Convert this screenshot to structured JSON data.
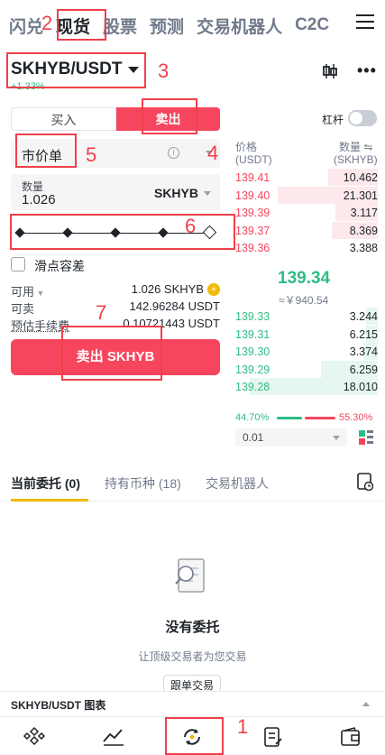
{
  "top_nav": {
    "items": [
      "闪兑",
      "现货",
      "股票",
      "预测",
      "交易机器人",
      "C2C"
    ],
    "active_index": 1
  },
  "annotations": [
    "1",
    "2",
    "3",
    "4",
    "5",
    "6",
    "7"
  ],
  "pair": {
    "symbol": "SKHYB/USDT",
    "change": "+1.33%"
  },
  "trade_form": {
    "buy_tab": "买入",
    "sell_tab": "卖出",
    "leverage_label": "杠杆",
    "order_type": "市价单",
    "quantity_label": "数量",
    "quantity_value": "1.026",
    "quantity_unit": "SKHYB",
    "slider_percent": 100,
    "slippage_label": "滑点容差",
    "available_label": "可用",
    "available_value": "1.026 SKHYB",
    "sellable_label": "可卖",
    "sellable_value": "142.96284 USDT",
    "fee_label": "预估手续费",
    "fee_value": "0.10721443 USDT",
    "submit_label": "卖出 SKHYB"
  },
  "order_book": {
    "price_header": "价格",
    "price_unit": "(USDT)",
    "qty_header": "数量 ⇋",
    "qty_unit": "(SKHYB)",
    "asks": [
      {
        "price": "139.41",
        "qty": "10.462",
        "depth": 0.35
      },
      {
        "price": "139.40",
        "qty": "21.301",
        "depth": 0.7
      },
      {
        "price": "139.39",
        "qty": "3.117",
        "depth": 0.3
      },
      {
        "price": "139.37",
        "qty": "8.369",
        "depth": 0.32
      },
      {
        "price": "139.36",
        "qty": "3.388",
        "depth": 0.0
      }
    ],
    "mid_price": "139.34",
    "mid_fiat": "≈￥940.54",
    "bids": [
      {
        "price": "139.33",
        "qty": "3.244",
        "depth": 0.08
      },
      {
        "price": "139.31",
        "qty": "6.215",
        "depth": 0.08
      },
      {
        "price": "139.30",
        "qty": "3.374",
        "depth": 0.1
      },
      {
        "price": "139.29",
        "qty": "6.259",
        "depth": 0.4
      },
      {
        "price": "139.28",
        "qty": "18.010",
        "depth": 0.9
      }
    ],
    "buy_ratio": "44.70%",
    "sell_ratio": "55.30%",
    "precision": "0.01"
  },
  "orders": {
    "tabs": [
      "当前委托 (0)",
      "持有币种 (18)",
      "交易机器人"
    ],
    "empty_title": "没有委托",
    "empty_subtitle": "让顶级交易者为您交易",
    "follow_button": "跟单交易"
  },
  "chart_bar": {
    "title": "SKHYB/USDT 图表"
  },
  "colors": {
    "sell": "#f6465d",
    "buy": "#2ebd85",
    "accent": "#f0b90b",
    "annotation": "#f0404b"
  }
}
